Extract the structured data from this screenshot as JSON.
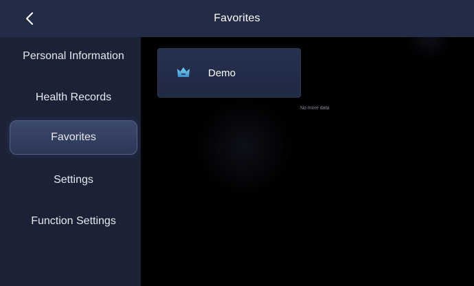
{
  "header": {
    "title": "Favorites",
    "back_icon": "chevron-left-icon"
  },
  "sidebar": {
    "items": [
      {
        "label": "Personal Information",
        "active": false
      },
      {
        "label": "Health Records",
        "active": false
      },
      {
        "label": "Favorites",
        "active": true
      },
      {
        "label": "Settings",
        "active": false
      },
      {
        "label": "Function Settings",
        "active": false
      }
    ]
  },
  "favorites": {
    "items": [
      {
        "label": "Demo",
        "icon": "crown-icon"
      }
    ],
    "end_text": "No more data"
  },
  "colors": {
    "header_bg": "#232c47",
    "sidebar_bg": "#1b2236",
    "card_bg": "#263150",
    "crown_accent": "#5fb8e8"
  }
}
